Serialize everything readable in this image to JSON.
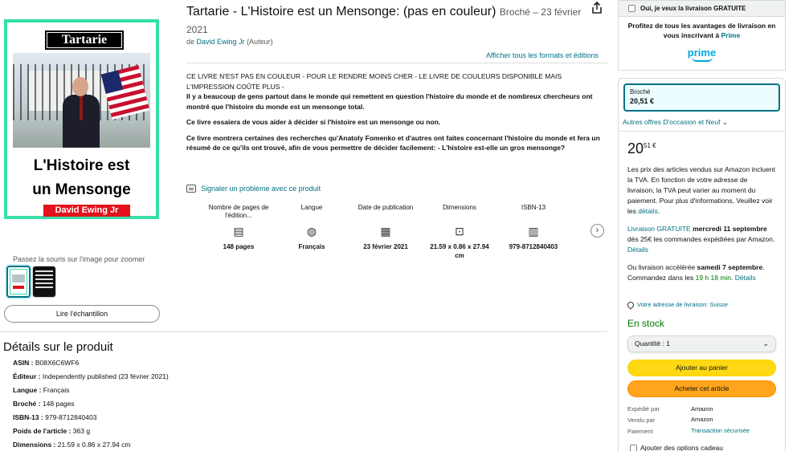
{
  "book": {
    "title": "Tartarie - L'Histoire est un Mensonge: (pas en couleur)",
    "format_date": "Broché – 23 février",
    "year": "2021",
    "by_prefix": "de",
    "author": "David Ewing Jr",
    "author_role": "(Auteur)",
    "all_formats": "Afficher tous les formats et éditions"
  },
  "cover": {
    "title": "Tartarie",
    "line1": "L'Histoire est",
    "line2": "un Mensonge",
    "author": "David Ewing Jr"
  },
  "gallery": {
    "zoom_hint": "Passez la souris sur l'image pour zoomer",
    "sample_button": "Lire l'échantillon"
  },
  "description": {
    "p1": "CE LIVRE N'EST PAS EN COULEUR - POUR LE RENDRE MOINS CHER - LE LIVRE DE COULEURS DISPONIBLE MAIS L'IMPRESSION COÛTE PLUS -",
    "p1b": "Il y a beaucoup de gens partout dans le monde qui remettent en question l'histoire du monde et de nombreux chercheurs ont montré que l'histoire du monde est un mensonge total.",
    "p2": "Ce livre essaiera de vous aider à décider si l'histoire est un mensonge ou non.",
    "p3": "Ce livre montrera certaines des recherches qu'Anatoly Fomenko et d'autres ont faites concernant l'histoire du monde et fera un résumé de ce qu'ils ont trouvé, afin de vous permettre de décider facilement: - L'histoire est-elle un gros mensonge?",
    "report": "Signaler un problème avec ce produit"
  },
  "attributes": [
    {
      "label": "Nombre de pages de l'édition...",
      "icon": "pages-icon",
      "glyph": "▤",
      "value": "148 pages"
    },
    {
      "label": "Langue",
      "icon": "globe-icon",
      "glyph": "◍",
      "value": "Français"
    },
    {
      "label": "Date de publication",
      "icon": "calendar-icon",
      "glyph": "▦",
      "value": "23 février 2021"
    },
    {
      "label": "Dimensions",
      "icon": "ruler-icon",
      "glyph": "⊡",
      "value": "21.59 x 0.86 x 27.94 cm"
    },
    {
      "label": "ISBN-13",
      "icon": "barcode-icon",
      "glyph": "▥",
      "value": "979-8712840403"
    }
  ],
  "details": {
    "heading": "Détails sur le produit",
    "rows": [
      {
        "k": "ASIN",
        "v": "B08X6C6WF6"
      },
      {
        "k": "Éditeur",
        "v": "Independently published (23 février 2021)"
      },
      {
        "k": "Langue",
        "v": "Français"
      },
      {
        "k": "Broché",
        "v": "148 pages"
      },
      {
        "k": "ISBN-13",
        "v": "979-8712840403"
      },
      {
        "k": "Poids de l'article",
        "v": "363 g"
      },
      {
        "k": "Dimensions",
        "v": "21.59 x 0.86 x 27.94 cm"
      }
    ]
  },
  "prime": {
    "checkbox_label": "Oui, je veux la livraison GRATUITE",
    "text": "Profitez de tous les avantages de livraison en vous inscrivant à",
    "link": "Prime",
    "logo": "prime"
  },
  "buybox": {
    "format_name": "Broché",
    "format_price": "20,51 €",
    "used_offers": "Autres offres D'occasion et Neuf",
    "price_whole": "20",
    "price_fraction": "51 €",
    "tax_text": "Les prix des articles vendus sur Amazon incluent la TVA. En fonction de votre adresse de livraison, la TVA peut varier au moment du paiement. Pour plus d'informations, Veuillez voir les",
    "tax_link": "détails",
    "delivery_free_label": "Livraison GRATUITE",
    "delivery_free_date": "mercredi 11 septembre",
    "delivery_free_rest": "dès 25€ les commandes expédiées par Amazon.",
    "details_link": "Détails",
    "fast_prefix": "Ou livraison accélérée",
    "fast_date": "samedi 7 septembre",
    "fast_mid": ". Commandez dans les",
    "fast_time": "19 h 18 min",
    "location": "Votre adresse de livraison: Suisse",
    "stock": "En stock",
    "quantity": "Quantité : 1",
    "add_to_cart": "Ajouter au panier",
    "buy_now": "Acheter cet article",
    "shipped_by_label": "Expédié par",
    "shipped_by": "Amazon",
    "sold_by_label": "Vendu par",
    "sold_by": "Amazon",
    "payment_label": "Paiement",
    "payment": "Transaction sécurisée",
    "add_options": "Ajouter des options cadeau"
  },
  "colors": {
    "link": "#007185",
    "cover_border": "#35e0a6",
    "cart": "#ffd814",
    "buy": "#ffa41c",
    "stock": "#007600"
  }
}
